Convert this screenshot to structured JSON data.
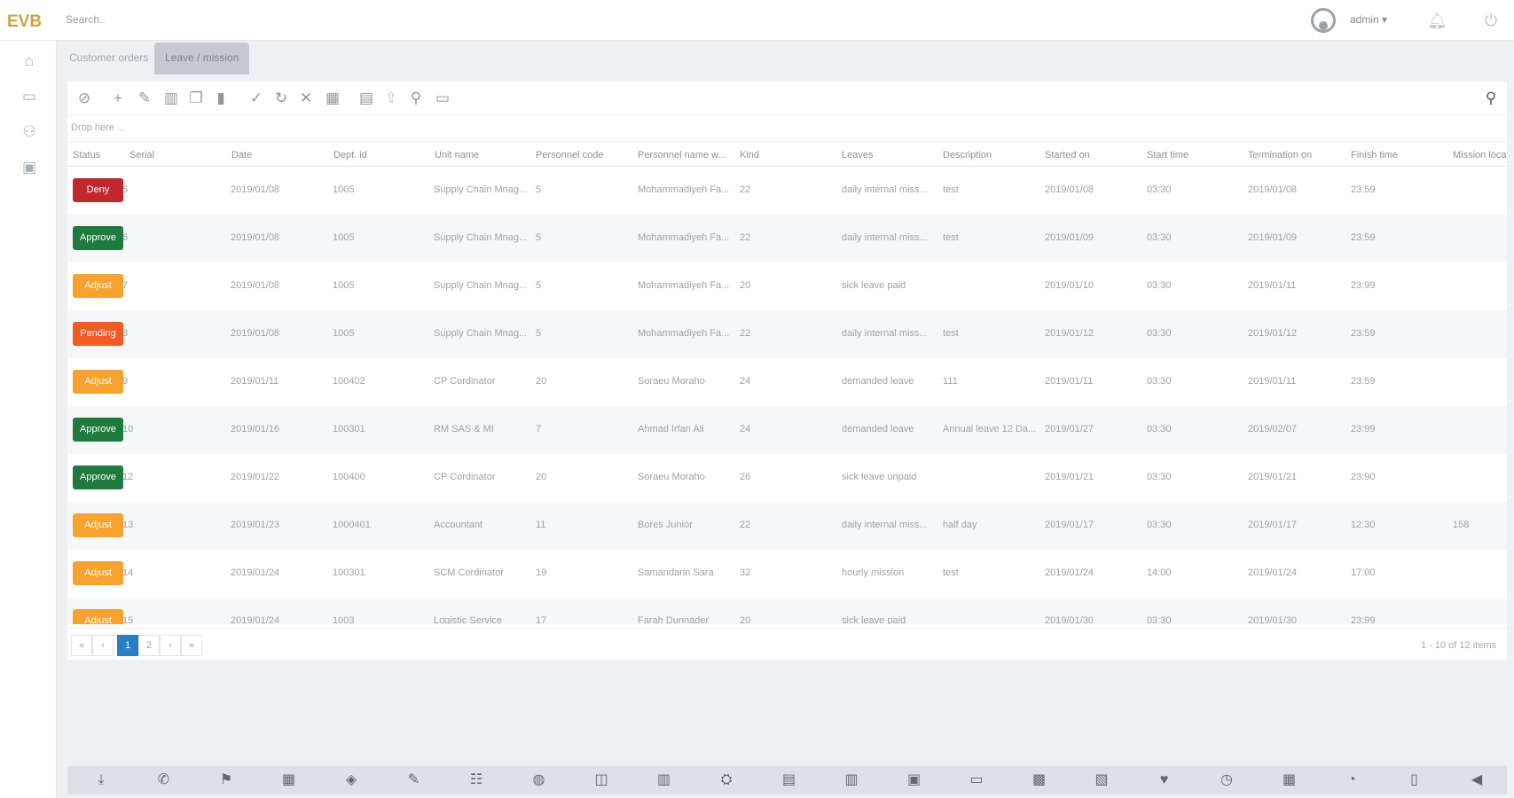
{
  "header": {
    "logo_text": "EVB",
    "search_placeholder": "Search..",
    "user_label": "admin ▾",
    "icons": [
      "bell-icon",
      "power-icon"
    ]
  },
  "sidebar": {
    "icons": [
      "home-icon",
      "folder-icon",
      "users-icon",
      "image-icon"
    ]
  },
  "tabs": [
    {
      "label": "Customer orders"
    },
    {
      "label": "Leave / mission"
    }
  ],
  "toolbar": {
    "icons": [
      "paperclip-icon",
      "plus-icon",
      "pencil-icon",
      "lock-icon",
      "copy-icon",
      "trash-icon",
      "check-icon",
      "refresh-icon",
      "close-icon",
      "grid-icon",
      "document-icon",
      "upload-icon",
      "hierarchy-icon",
      "table-icon"
    ],
    "search_icon": "search-icon"
  },
  "grid": {
    "group_drop": "Drop here ...",
    "columns": [
      "Status",
      "Serial",
      "Date",
      "Dept. id",
      "Unit name",
      "Personnel code",
      "Personnel name w...",
      "Kind",
      "Leaves",
      "Description",
      "Started on",
      "Start time",
      "Termination on",
      "Finish time",
      "Mission loca"
    ],
    "status_colors": {
      "Deny": "#c0282d",
      "Approve": "#1f7a3d",
      "Adjust": "#f5a22e",
      "Pending": "#f15a24"
    },
    "rows": [
      {
        "status": "Deny",
        "serial": "5",
        "date": "2019/01/08",
        "dept": "1005",
        "unit": "Supply Chain Mnag...",
        "pcode": "5",
        "pname": "Mohammadiyeh Fa...",
        "kind": "22",
        "leaves": "daily internal miss...",
        "desc": "test",
        "started": "2019/01/08",
        "start_time": "03:30",
        "term": "2019/01/08",
        "finish": "23:59",
        "loc": ""
      },
      {
        "status": "Approve",
        "serial": "6",
        "date": "2019/01/08",
        "dept": "1005",
        "unit": "Supply Chain Mnag...",
        "pcode": "5",
        "pname": "Mohammadiyeh Fa...",
        "kind": "22",
        "leaves": "daily internal miss...",
        "desc": "test",
        "started": "2019/01/09",
        "start_time": "03:30",
        "term": "2019/01/09",
        "finish": "23:59",
        "loc": ""
      },
      {
        "status": "Adjust",
        "serial": "7",
        "date": "2019/01/08",
        "dept": "1005",
        "unit": "Supply Chain Mnag...",
        "pcode": "5",
        "pname": "Mohammadiyeh Fa...",
        "kind": "20",
        "leaves": "sick leave paid",
        "desc": "",
        "started": "2019/01/10",
        "start_time": "03:30",
        "term": "2019/01/11",
        "finish": "23:99",
        "loc": ""
      },
      {
        "status": "Pending",
        "serial": "8",
        "date": "2019/01/08",
        "dept": "1005",
        "unit": "Supply Chain Mnag...",
        "pcode": "5",
        "pname": "Mohammadiyeh Fa...",
        "kind": "22",
        "leaves": "daily internal miss...",
        "desc": "test",
        "started": "2019/01/12",
        "start_time": "03:30",
        "term": "2019/01/12",
        "finish": "23:59",
        "loc": ""
      },
      {
        "status": "Adjust",
        "serial": "9",
        "date": "2019/01/11",
        "dept": "100402",
        "unit": "CP Cordinator",
        "pcode": "20",
        "pname": "Soraeu Moraho",
        "kind": "24",
        "leaves": "demanded leave",
        "desc": "111",
        "started": "2019/01/11",
        "start_time": "03:30",
        "term": "2019/01/11",
        "finish": "23:59",
        "loc": ""
      },
      {
        "status": "Approve",
        "serial": "10",
        "date": "2019/01/16",
        "dept": "100301",
        "unit": "RM SAS & MI",
        "pcode": "7",
        "pname": "Ahmad Irfan Ali",
        "kind": "24",
        "leaves": "demanded leave",
        "desc": "Annual leave 12 Da...",
        "started": "2019/01/27",
        "start_time": "03:30",
        "term": "2019/02/07",
        "finish": "23:99",
        "loc": ""
      },
      {
        "status": "Approve",
        "serial": "12",
        "date": "2019/01/22",
        "dept": "100400",
        "unit": "CP Cordinator",
        "pcode": "20",
        "pname": "Soraeu Moraho",
        "kind": "26",
        "leaves": "sick leave unpaid",
        "desc": "",
        "started": "2019/01/21",
        "start_time": "03:30",
        "term": "2019/01/21",
        "finish": "23:90",
        "loc": ""
      },
      {
        "status": "Adjust",
        "serial": "13",
        "date": "2019/01/23",
        "dept": "1000401",
        "unit": "Accountant",
        "pcode": "11",
        "pname": "Bores Junior",
        "kind": "22",
        "leaves": "daily internal miss...",
        "desc": "half day",
        "started": "2019/01/17",
        "start_time": "03:30",
        "term": "2019/01/17",
        "finish": "12:30",
        "loc": "158"
      },
      {
        "status": "Adjust",
        "serial": "14",
        "date": "2019/01/24",
        "dept": "100301",
        "unit": "SCM Cordinator",
        "pcode": "19",
        "pname": "Samandarin Sara",
        "kind": "32",
        "leaves": "hourly mission",
        "desc": "test",
        "started": "2019/01/24",
        "start_time": "14:00",
        "term": "2019/01/24",
        "finish": "17:00",
        "loc": ""
      },
      {
        "status": "Adjust",
        "serial": "15",
        "date": "2019/01/24",
        "dept": "1003",
        "unit": "Logistic Service",
        "pcode": "17",
        "pname": "Farah Dunnader",
        "kind": "20",
        "leaves": "sick leave paid",
        "desc": "",
        "started": "2019/01/30",
        "start_time": "03:30",
        "term": "2019/01/30",
        "finish": "23:99",
        "loc": ""
      }
    ]
  },
  "pager": {
    "first": "«",
    "prev": "‹",
    "pages": [
      "1",
      "2"
    ],
    "next": "›",
    "last": "»",
    "info": "1 - 10 of 12 items"
  },
  "bottom_bar": {
    "icons": [
      "download-icon",
      "phone-icon",
      "flag-icon",
      "calendar-grid-icon",
      "tag-icon",
      "pin-icon",
      "list-icon",
      "globe-icon",
      "chart-icon",
      "lock-icon",
      "org-chart-icon",
      "document-icon",
      "columns-icon",
      "save-icon",
      "monitor-icon",
      "excel-icon",
      "word-icon",
      "heart-icon",
      "clock-icon",
      "building-icon",
      "chat-icon",
      "clipboard-icon",
      "megaphone-icon"
    ]
  }
}
